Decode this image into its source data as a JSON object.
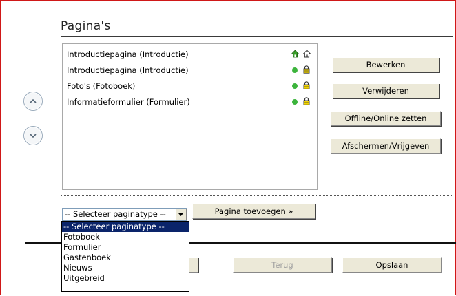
{
  "page": {
    "title": "Pagina's"
  },
  "pages_list": [
    {
      "label": "Introductiepagina (Introductie)",
      "status": "home"
    },
    {
      "label": "Introductiepagina (Introductie)",
      "status": "online"
    },
    {
      "label": "Foto's (Fotoboek)",
      "status": "online"
    },
    {
      "label": "Informatieformulier (Formulier)",
      "status": "online"
    }
  ],
  "actions": {
    "edit": "Bewerken",
    "delete": "Verwijderen",
    "toggle_online": "Offline/Online zetten",
    "shield": "Afschermen/Vrijgeven"
  },
  "add_page": {
    "select_value": "-- Selecteer paginatype --",
    "add_button": "Pagina toevoegen »",
    "options": [
      "-- Selecteer paginatype --",
      "Fotoboek",
      "Formulier",
      "Gastenboek",
      "Nieuws",
      "Uitgebreid"
    ]
  },
  "footer": {
    "back": "Terug",
    "save": "Opslaan"
  },
  "colors": {
    "accent_red": "#d01818",
    "online_green": "#3cb43c",
    "lock_yellow": "#f2d400",
    "selection_blue": "#0a246a"
  }
}
